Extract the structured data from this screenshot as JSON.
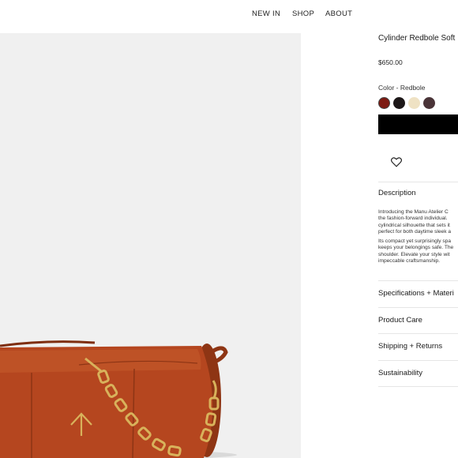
{
  "nav": {
    "new_in": "NEW IN",
    "shop": "SHOP",
    "about": "ABOUT"
  },
  "product": {
    "title": "Cylinder Redbole Soft",
    "price": "$650.00",
    "color_label": "Color - Redbole",
    "swatches": [
      {
        "name": "redbole",
        "hex": "#7d1a12",
        "selected": true
      },
      {
        "name": "black",
        "hex": "#1c1718",
        "selected": false
      },
      {
        "name": "cream",
        "hex": "#efe2c4",
        "selected": false
      },
      {
        "name": "dark-brown",
        "hex": "#4a3438",
        "selected": false
      }
    ],
    "bag_color": "#b5461f",
    "hardware_color": "#d8b25b"
  },
  "sections": {
    "description_title": "Description",
    "description_lines": [
      "Introducing the Manu Atelier C",
      "the fashion-forward individual.",
      "cylindrical silhouette that sets it",
      "perfect for both daytime sleek a"
    ],
    "description_lines_2": [
      "Its compact yet surprisingly spa",
      "keeps your belongings safe. The",
      "shoulder. Elevate your style wit",
      "impeccable craftsmanship."
    ],
    "specifications": "Specifications + Materi",
    "product_care": "Product Care",
    "shipping": "Shipping + Returns",
    "sustainability": "Sustainability"
  }
}
